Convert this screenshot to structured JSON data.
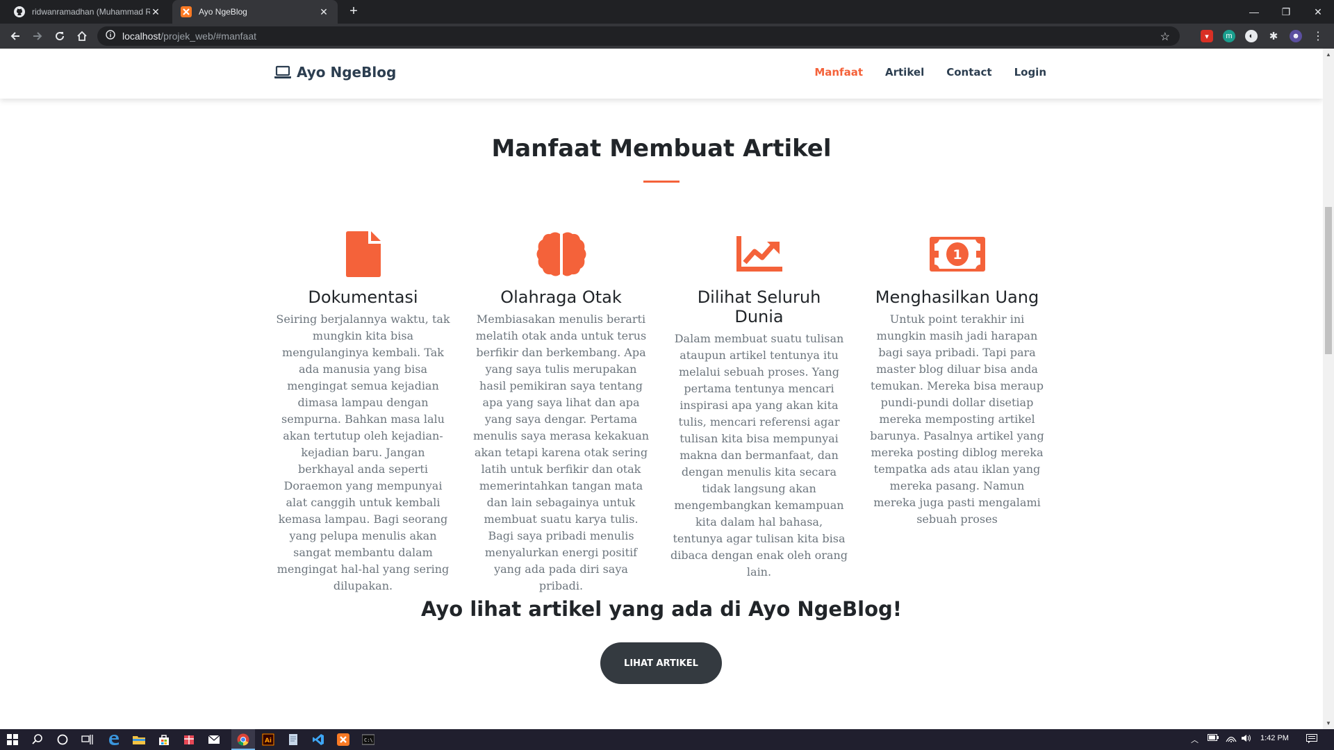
{
  "browser": {
    "tabs": [
      {
        "title": "ridwanramadhan (Muhammad Ri",
        "favicon": "github-icon",
        "active": false
      },
      {
        "title": "Ayo NgeBlog",
        "favicon": "xampp-icon",
        "active": true
      }
    ],
    "url_host": "localhost",
    "url_path": "/projek_web/#manfaat"
  },
  "site": {
    "brand": "Ayo NgeBlog",
    "nav": [
      {
        "label": "Manfaat",
        "active": true
      },
      {
        "label": "Artikel",
        "active": false
      },
      {
        "label": "Contact",
        "active": false
      },
      {
        "label": "Login",
        "active": false
      }
    ],
    "accent_color": "#f4623a"
  },
  "section": {
    "title": "Manfaat Membuat Artikel",
    "features": [
      {
        "icon": "file-icon",
        "title": "Dokumentasi",
        "text": "Seiring berjalannya waktu, tak mungkin kita bisa mengulanginya kembali. Tak ada manusia yang bisa mengingat semua kejadian dimasa lampau dengan sempurna. Bahkan masa lalu akan tertutup oleh kejadian-kejadian baru. Jangan berkhayal anda seperti Doraemon yang mempunyai alat canggih untuk kembali kemasa lampau. Bagi seorang yang pelupa menulis akan sangat membantu dalam mengingat hal-hal yang sering dilupakan."
      },
      {
        "icon": "brain-icon",
        "title": "Olahraga Otak",
        "text": "Membiasakan menulis berarti melatih otak anda untuk terus berfikir dan berkembang. Apa yang saya tulis merupakan hasil pemikiran saya tentang apa yang saya lihat dan apa yang saya dengar. Pertama menulis saya merasa kekakuan akan tetapi karena otak sering latih untuk berfikir dan otak memerintahkan tangan mata dan lain sebagainya untuk membuat suatu karya tulis. Bagi saya pribadi menulis menyalurkan energi positif yang ada pada diri saya pribadi."
      },
      {
        "icon": "chart-line-icon",
        "title": "Dilihat Seluruh Dunia",
        "text": "Dalam membuat suatu tulisan ataupun artikel tentunya itu melalui sebuah proses. Yang pertama tentunya mencari inspirasi apa yang akan kita tulis, mencari referensi agar tulisan kita bisa mempunyai makna dan bermanfaat, dan dengan menulis kita secara tidak langsung akan mengembangkan kemampuan kita dalam hal bahasa, tentunya agar tulisan kita bisa dibaca dengan enak oleh orang lain."
      },
      {
        "icon": "money-bill-icon",
        "title": "Menghasilkan Uang",
        "text": "Untuk point terakhir ini mungkin masih jadi harapan bagi saya pribadi. Tapi para master blog diluar bisa anda temukan. Mereka bisa meraup pundi-pundi dollar disetiap mereka memposting artikel barunya. Pasalnya artikel yang mereka posting diblog mereka tempatka ads atau iklan yang mereka pasang. Namun mereka juga pasti mengalami sebuah proses"
      }
    ],
    "cta_heading": "Ayo lihat artikel yang ada di Ayo NgeBlog!",
    "cta_button": "LIHAT ARTIKEL"
  },
  "taskbar": {
    "time": "1:42 PM"
  }
}
